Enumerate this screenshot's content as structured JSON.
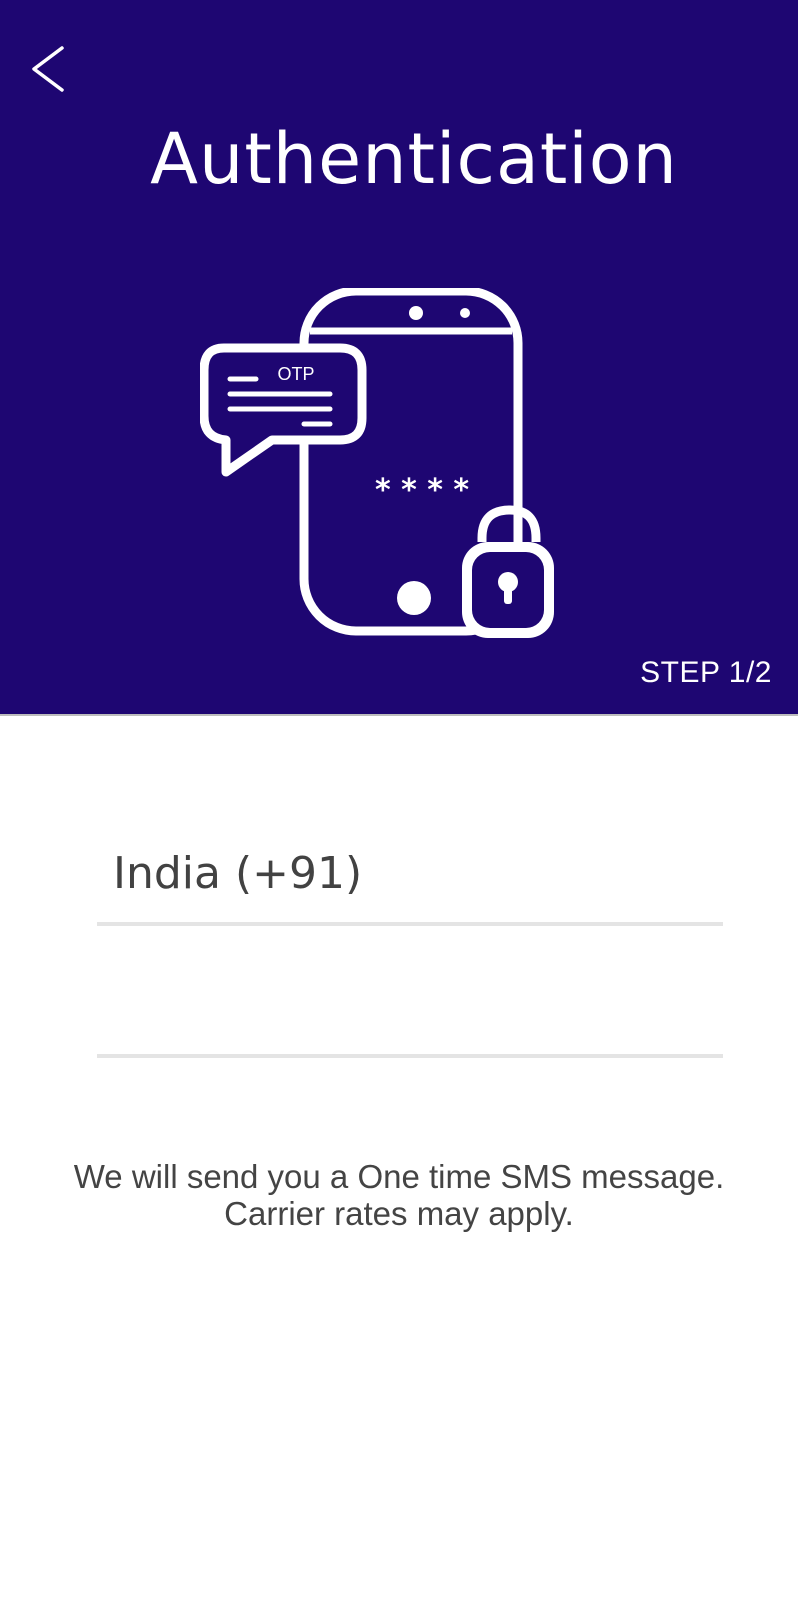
{
  "colors": {
    "header_background": "#1e0672",
    "header_text": "#ffffff",
    "field_underline": "#e4e4e4",
    "body_text": "#444444"
  },
  "header": {
    "back_icon": "chevron-left-icon",
    "title": "Authentication",
    "step_label": "STEP 1/2"
  },
  "illustration": {
    "icon": "phone-otp-lock-icon",
    "otp_label": "OTP",
    "masked_code": "* * * *"
  },
  "form": {
    "country": {
      "value": "India (+91)",
      "icon": "dropdown"
    },
    "phone": {
      "value": "",
      "placeholder": ""
    }
  },
  "info": {
    "line1": "We will send you a One time SMS message.",
    "line2": "Carrier rates may apply."
  }
}
